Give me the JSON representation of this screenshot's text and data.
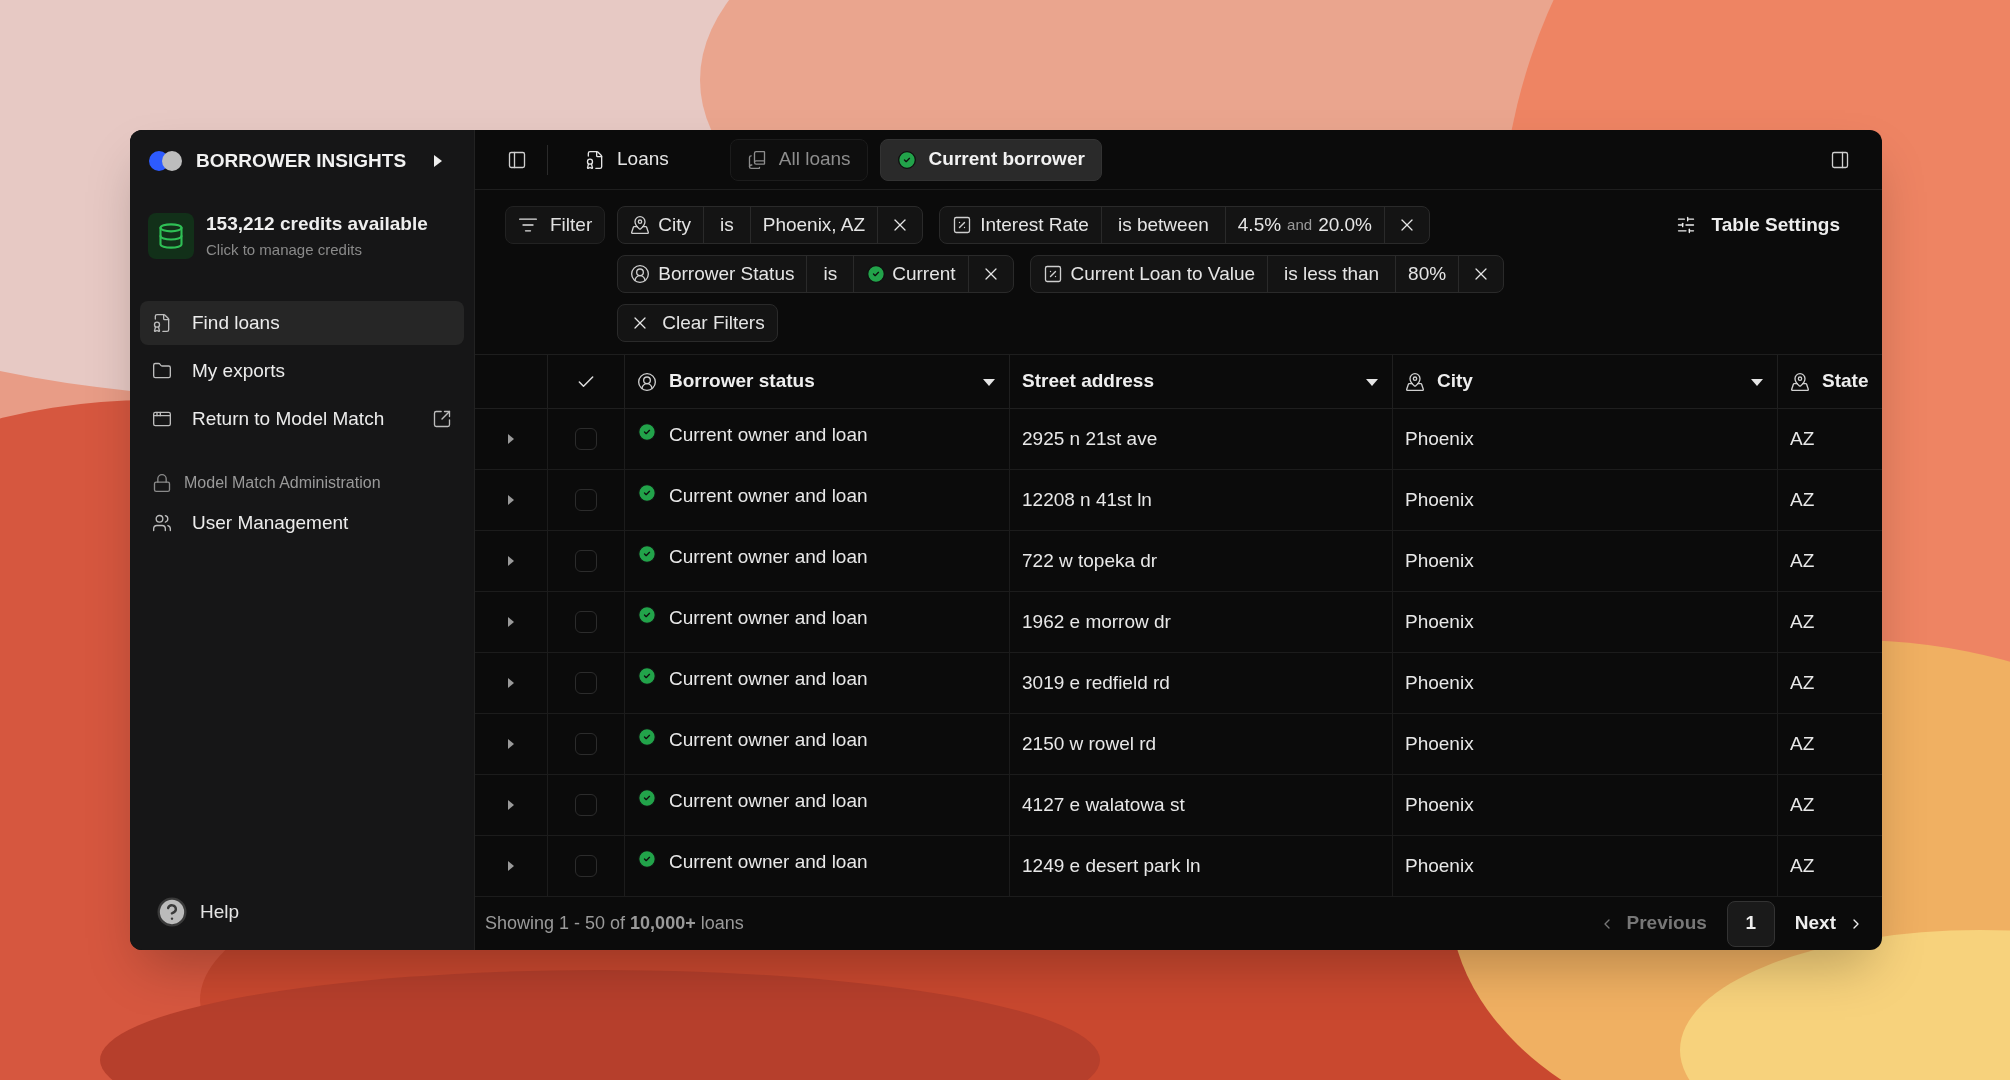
{
  "sidebar": {
    "title": "BORROWER INSIGHTS",
    "credits": {
      "title": "153,212 credits available",
      "subtitle": "Click to manage credits"
    },
    "items": [
      {
        "label": "Find loans",
        "selected": true
      },
      {
        "label": "My exports",
        "selected": false
      },
      {
        "label": "Return to Model Match",
        "selected": false
      }
    ],
    "section": {
      "title": "Model Match Administration",
      "items": [
        {
          "label": "User Management",
          "selected": false
        }
      ]
    },
    "help": "Help"
  },
  "tabs": [
    {
      "label": "Loans",
      "selected": false
    },
    {
      "label": "All loans",
      "selected": false
    },
    {
      "label": "Current borrower",
      "selected": true
    }
  ],
  "filter_button": "Filter",
  "table_settings": "Table Settings",
  "filter_rows": [
    [
      {
        "kind": "location",
        "field": "City",
        "operator": "is",
        "value": "Phoenix, AZ"
      },
      {
        "kind": "range",
        "field": "Interest Rate",
        "operator": "is between",
        "value": "4.5%",
        "joiner": "and",
        "value_to": "20.0%"
      }
    ],
    [
      {
        "kind": "status",
        "field": "Borrower Status",
        "operator": "is",
        "value": "Current"
      },
      {
        "kind": "threshold",
        "field": "Current Loan to Value",
        "operator": "is less than",
        "value": "80%"
      }
    ]
  ],
  "clear_filters": "Clear Filters",
  "table": {
    "columns": [
      {
        "label": "Borrower status"
      },
      {
        "label": "Street address"
      },
      {
        "label": "City"
      },
      {
        "label": "State"
      }
    ],
    "rows": [
      {
        "status": "Current owner and loan",
        "street": "2925 n 21st ave",
        "city": "Phoenix",
        "state": "AZ",
        "checked": false
      },
      {
        "status": "Current owner and loan",
        "street": "12208 n 41st ln",
        "city": "Phoenix",
        "state": "AZ",
        "checked": false
      },
      {
        "status": "Current owner and loan",
        "street": "722 w topeka dr",
        "city": "Phoenix",
        "state": "AZ",
        "checked": false
      },
      {
        "status": "Current owner and loan",
        "street": "1962 e morrow dr",
        "city": "Phoenix",
        "state": "AZ",
        "checked": false
      },
      {
        "status": "Current owner and loan",
        "street": "3019 e redfield rd",
        "city": "Phoenix",
        "state": "AZ",
        "checked": false
      },
      {
        "status": "Current owner and loan",
        "street": "2150 w rowel rd",
        "city": "Phoenix",
        "state": "AZ",
        "checked": false
      },
      {
        "status": "Current owner and loan",
        "street": "4127 e walatowa st",
        "city": "Phoenix",
        "state": "AZ",
        "checked": false
      },
      {
        "status": "Current owner and loan",
        "street": "1249 e desert park ln",
        "city": "Phoenix",
        "state": "AZ",
        "checked": false
      }
    ]
  },
  "footer": {
    "summary": "Showing 1 - 50 of **10,000+** loans",
    "previous": {
      "label": "Previous",
      "disabled": true
    },
    "pages": [
      {
        "label": "1",
        "selected": true
      }
    ],
    "next": {
      "label": "Next",
      "disabled": false
    }
  }
}
